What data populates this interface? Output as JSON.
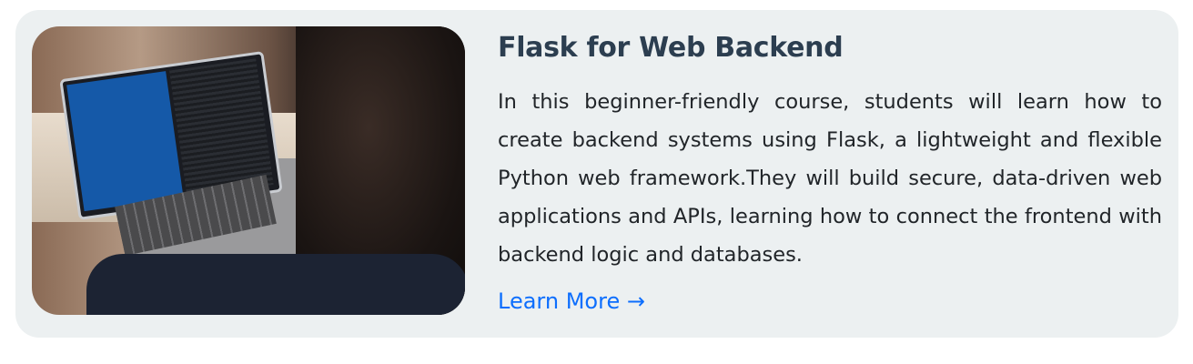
{
  "course": {
    "title": "Flask for Web Backend",
    "description": "In this beginner-friendly course, students will learn how to create backend systems using Flask, a lightweight and flexible Python web framework.They will build secure, data-driven web applications and APIs, learning how to connect the frontend with backend logic and databases.",
    "link_label": "Learn More →",
    "image_alt": "Person typing on a laptop showing code"
  },
  "colors": {
    "card_bg": "#ecf0f1",
    "title": "#2c3e50",
    "link": "#0d6efd"
  }
}
